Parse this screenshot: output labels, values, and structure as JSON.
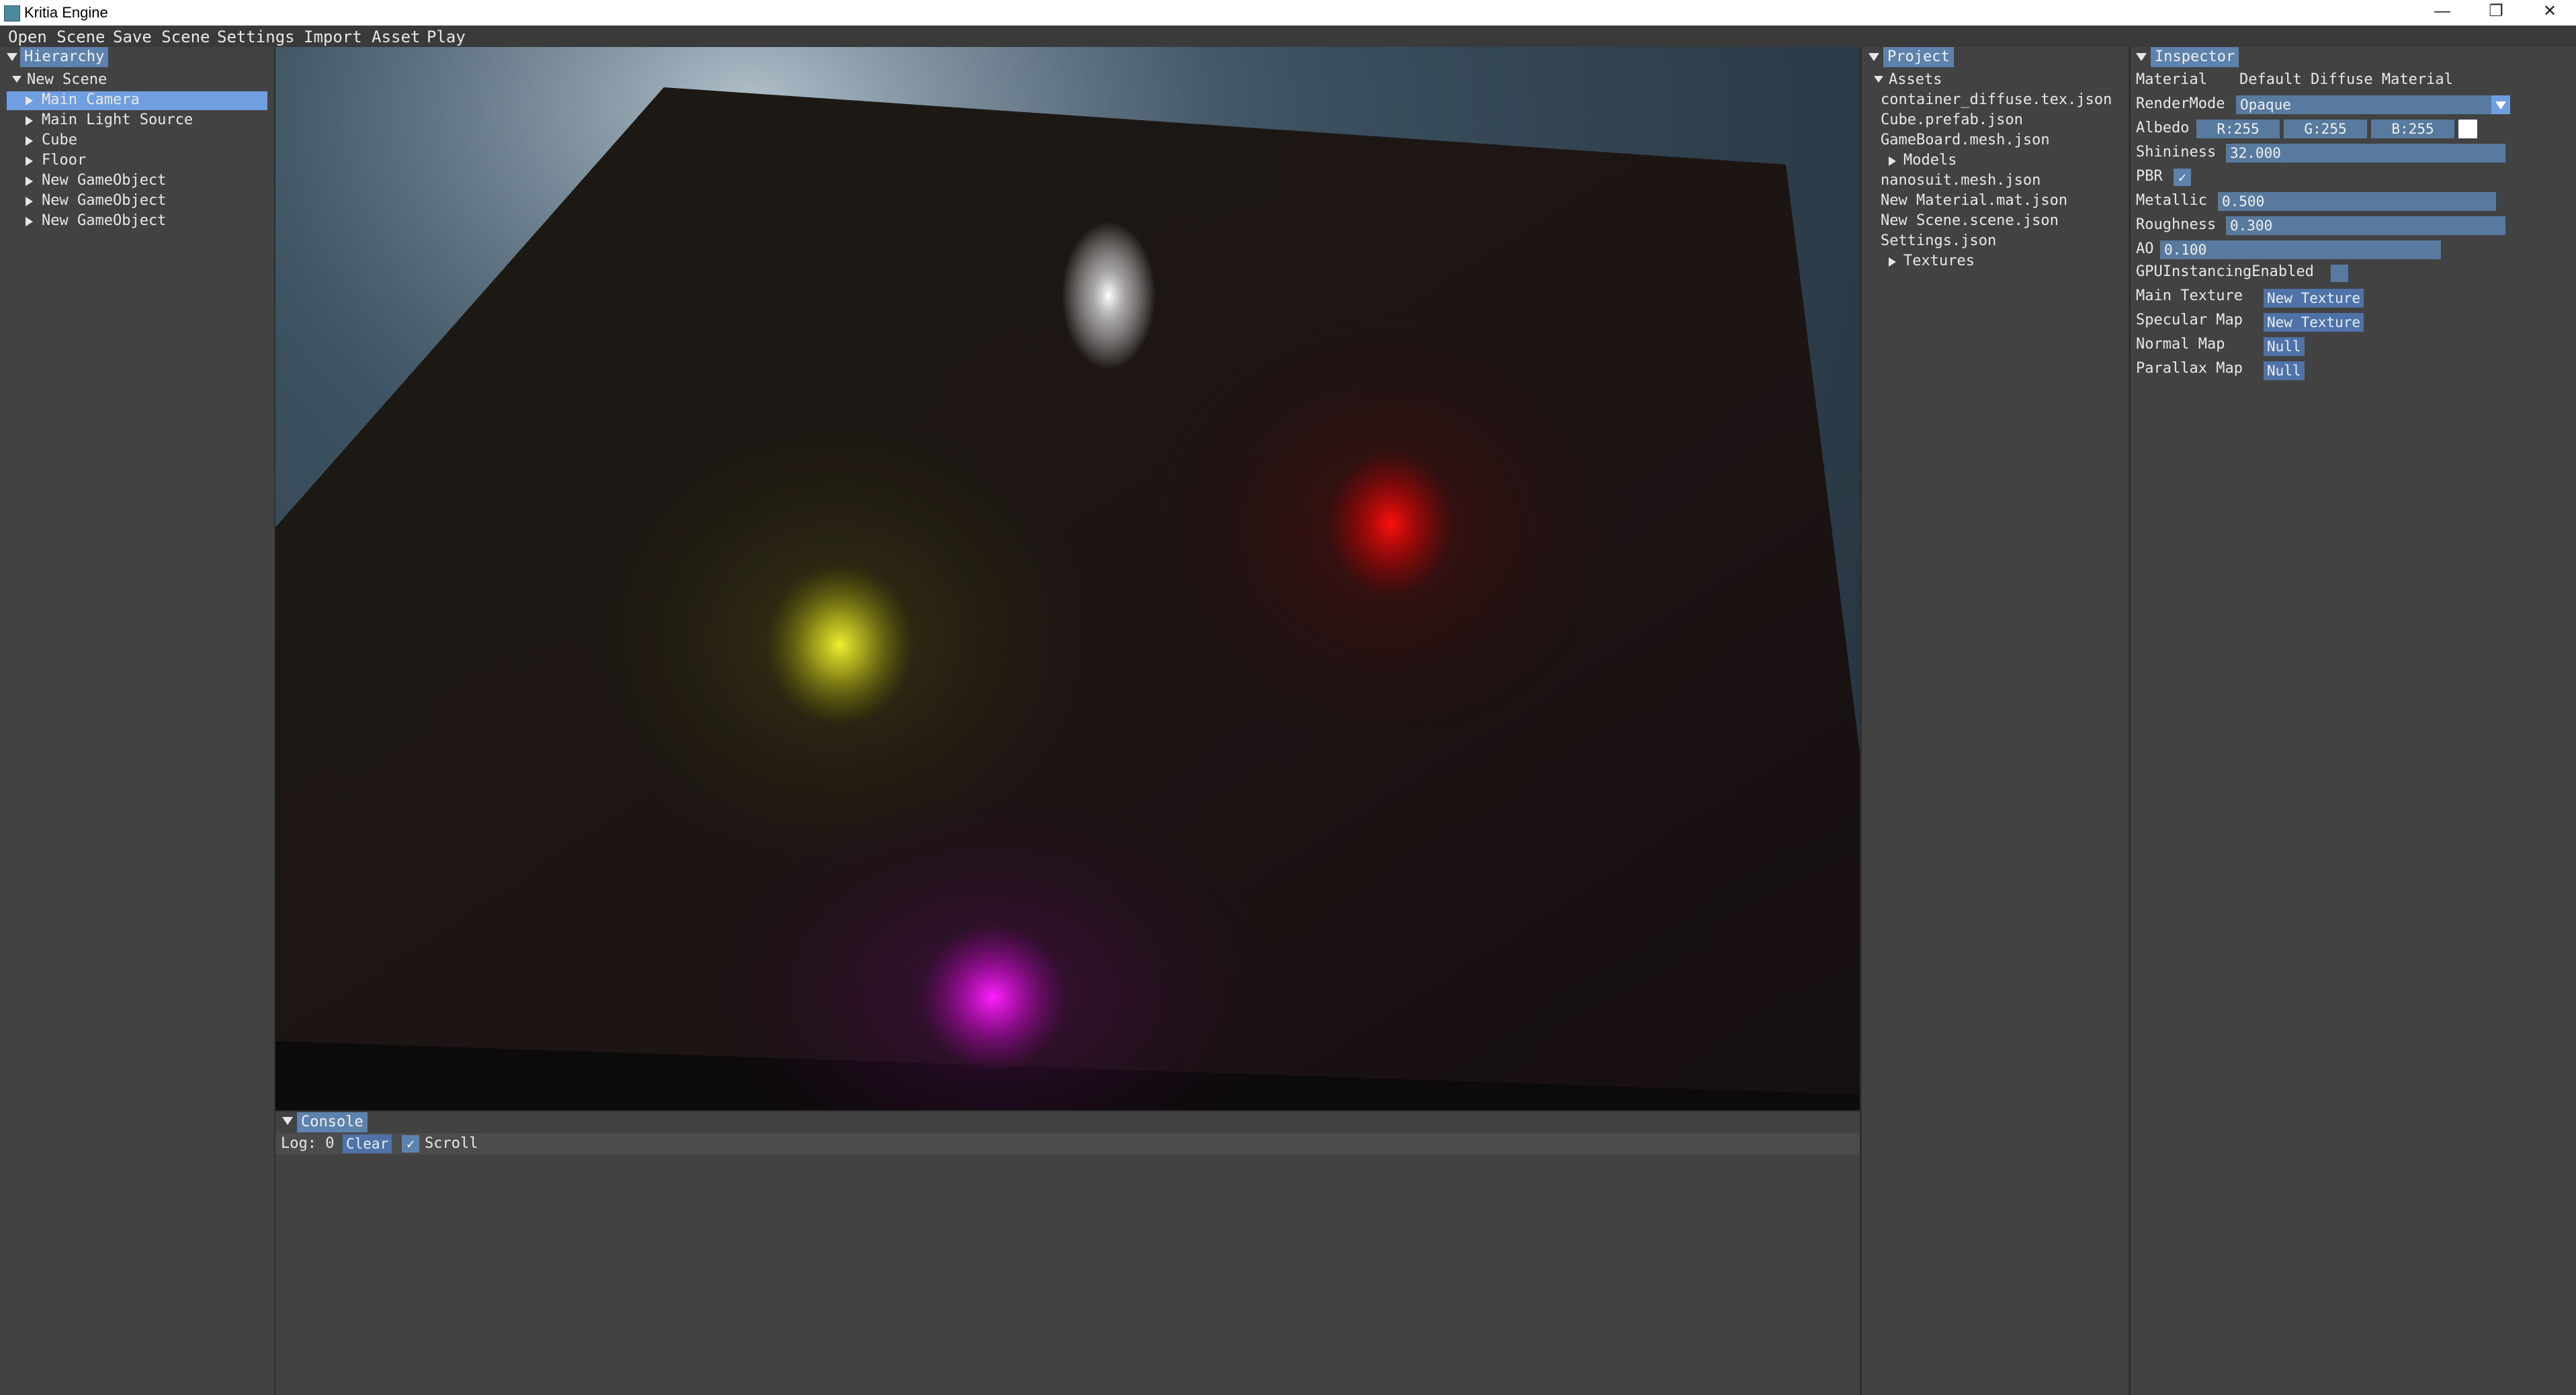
{
  "window": {
    "title": "Kritia Engine",
    "minimize": "—",
    "restore": "❐",
    "close": "✕"
  },
  "menu": [
    "Open Scene",
    "Save Scene",
    "Settings",
    "Import Asset",
    "Play"
  ],
  "hierarchy": {
    "title": "Hierarchy",
    "root": "New Scene",
    "items": [
      "Main Camera",
      "Main Light Source",
      "Cube",
      "Floor",
      "New GameObject",
      "New GameObject",
      "New GameObject"
    ],
    "selected_index": 0
  },
  "project": {
    "title": "Project",
    "root": "Assets",
    "items": [
      {
        "label": "container_diffuse.tex.json",
        "folder": false
      },
      {
        "label": "Cube.prefab.json",
        "folder": false
      },
      {
        "label": "GameBoard.mesh.json",
        "folder": false
      },
      {
        "label": "Models",
        "folder": true
      },
      {
        "label": "nanosuit.mesh.json",
        "folder": false
      },
      {
        "label": "New Material.mat.json",
        "folder": false
      },
      {
        "label": "New Scene.scene.json",
        "folder": false
      },
      {
        "label": "Settings.json",
        "folder": false
      },
      {
        "label": "Textures",
        "folder": true
      }
    ]
  },
  "inspector": {
    "title": "Inspector",
    "material_label": "Material",
    "material_name": "Default Diffuse Material",
    "render_mode_label": "RenderMode",
    "render_mode_value": "Opaque",
    "albedo_label": "Albedo",
    "albedo_r": "R:255",
    "albedo_g": "G:255",
    "albedo_b": "B:255",
    "albedo_color": "#ffffff",
    "shininess_label": "Shininess",
    "shininess_value": "32.000",
    "pbr_label": "PBR",
    "pbr_checked": true,
    "metallic_label": "Metallic",
    "metallic_value": "0.500",
    "roughness_label": "Roughness",
    "roughness_value": "0.300",
    "ao_label": "AO",
    "ao_value": "0.100",
    "gpu_instancing_label": "GPUInstancingEnabled",
    "gpu_instancing_checked": false,
    "main_texture_label": "Main Texture",
    "main_texture_value": "New Texture",
    "specular_map_label": "Specular Map",
    "specular_map_value": "New Texture",
    "normal_map_label": "Normal Map",
    "normal_map_value": "Null",
    "parallax_map_label": "Parallax Map",
    "parallax_map_value": "Null"
  },
  "console": {
    "title": "Console",
    "log_label": "Log: 0",
    "clear_label": "Clear",
    "scroll_label": "Scroll",
    "scroll_checked": true
  },
  "scene_lights": [
    {
      "name": "white-light",
      "color": "#ffffff"
    },
    {
      "name": "red-light",
      "color": "#ff1010"
    },
    {
      "name": "yellow-light",
      "color": "#f0f030"
    },
    {
      "name": "magenta-light",
      "color": "#ff20ff"
    }
  ]
}
